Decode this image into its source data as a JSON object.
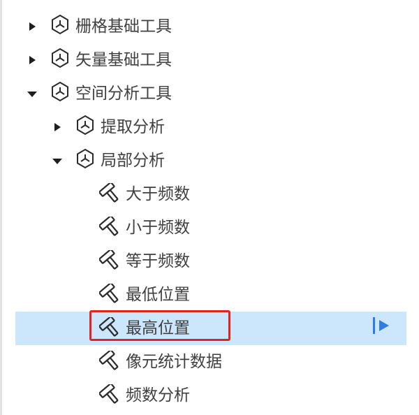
{
  "tree": {
    "items": [
      {
        "label": "栅格基础工具",
        "kind": "category",
        "expanded": false,
        "icon": "toolbox-icon"
      },
      {
        "label": "矢量基础工具",
        "kind": "category",
        "expanded": false,
        "icon": "toolbox-icon"
      },
      {
        "label": "空间分析工具",
        "kind": "category",
        "expanded": true,
        "icon": "toolbox-icon"
      },
      {
        "label": "提取分析",
        "kind": "category",
        "expanded": false,
        "icon": "toolbox-icon"
      },
      {
        "label": "局部分析",
        "kind": "category",
        "expanded": true,
        "icon": "toolbox-icon"
      },
      {
        "label": "大于频数",
        "kind": "tool",
        "icon": "hammer-icon"
      },
      {
        "label": "小于频数",
        "kind": "tool",
        "icon": "hammer-icon"
      },
      {
        "label": "等于频数",
        "kind": "tool",
        "icon": "hammer-icon"
      },
      {
        "label": "最低位置",
        "kind": "tool",
        "icon": "hammer-icon"
      },
      {
        "label": "最高位置",
        "kind": "tool",
        "icon": "hammer-icon",
        "selected": true
      },
      {
        "label": "像元统计数据",
        "kind": "tool",
        "icon": "hammer-icon"
      },
      {
        "label": "频数分析",
        "kind": "tool",
        "icon": "hammer-icon"
      }
    ]
  },
  "colors": {
    "selection": "#cce6fb",
    "highlight_border": "#e32222",
    "run_button": "#2f7de1",
    "text": "#404040"
  }
}
